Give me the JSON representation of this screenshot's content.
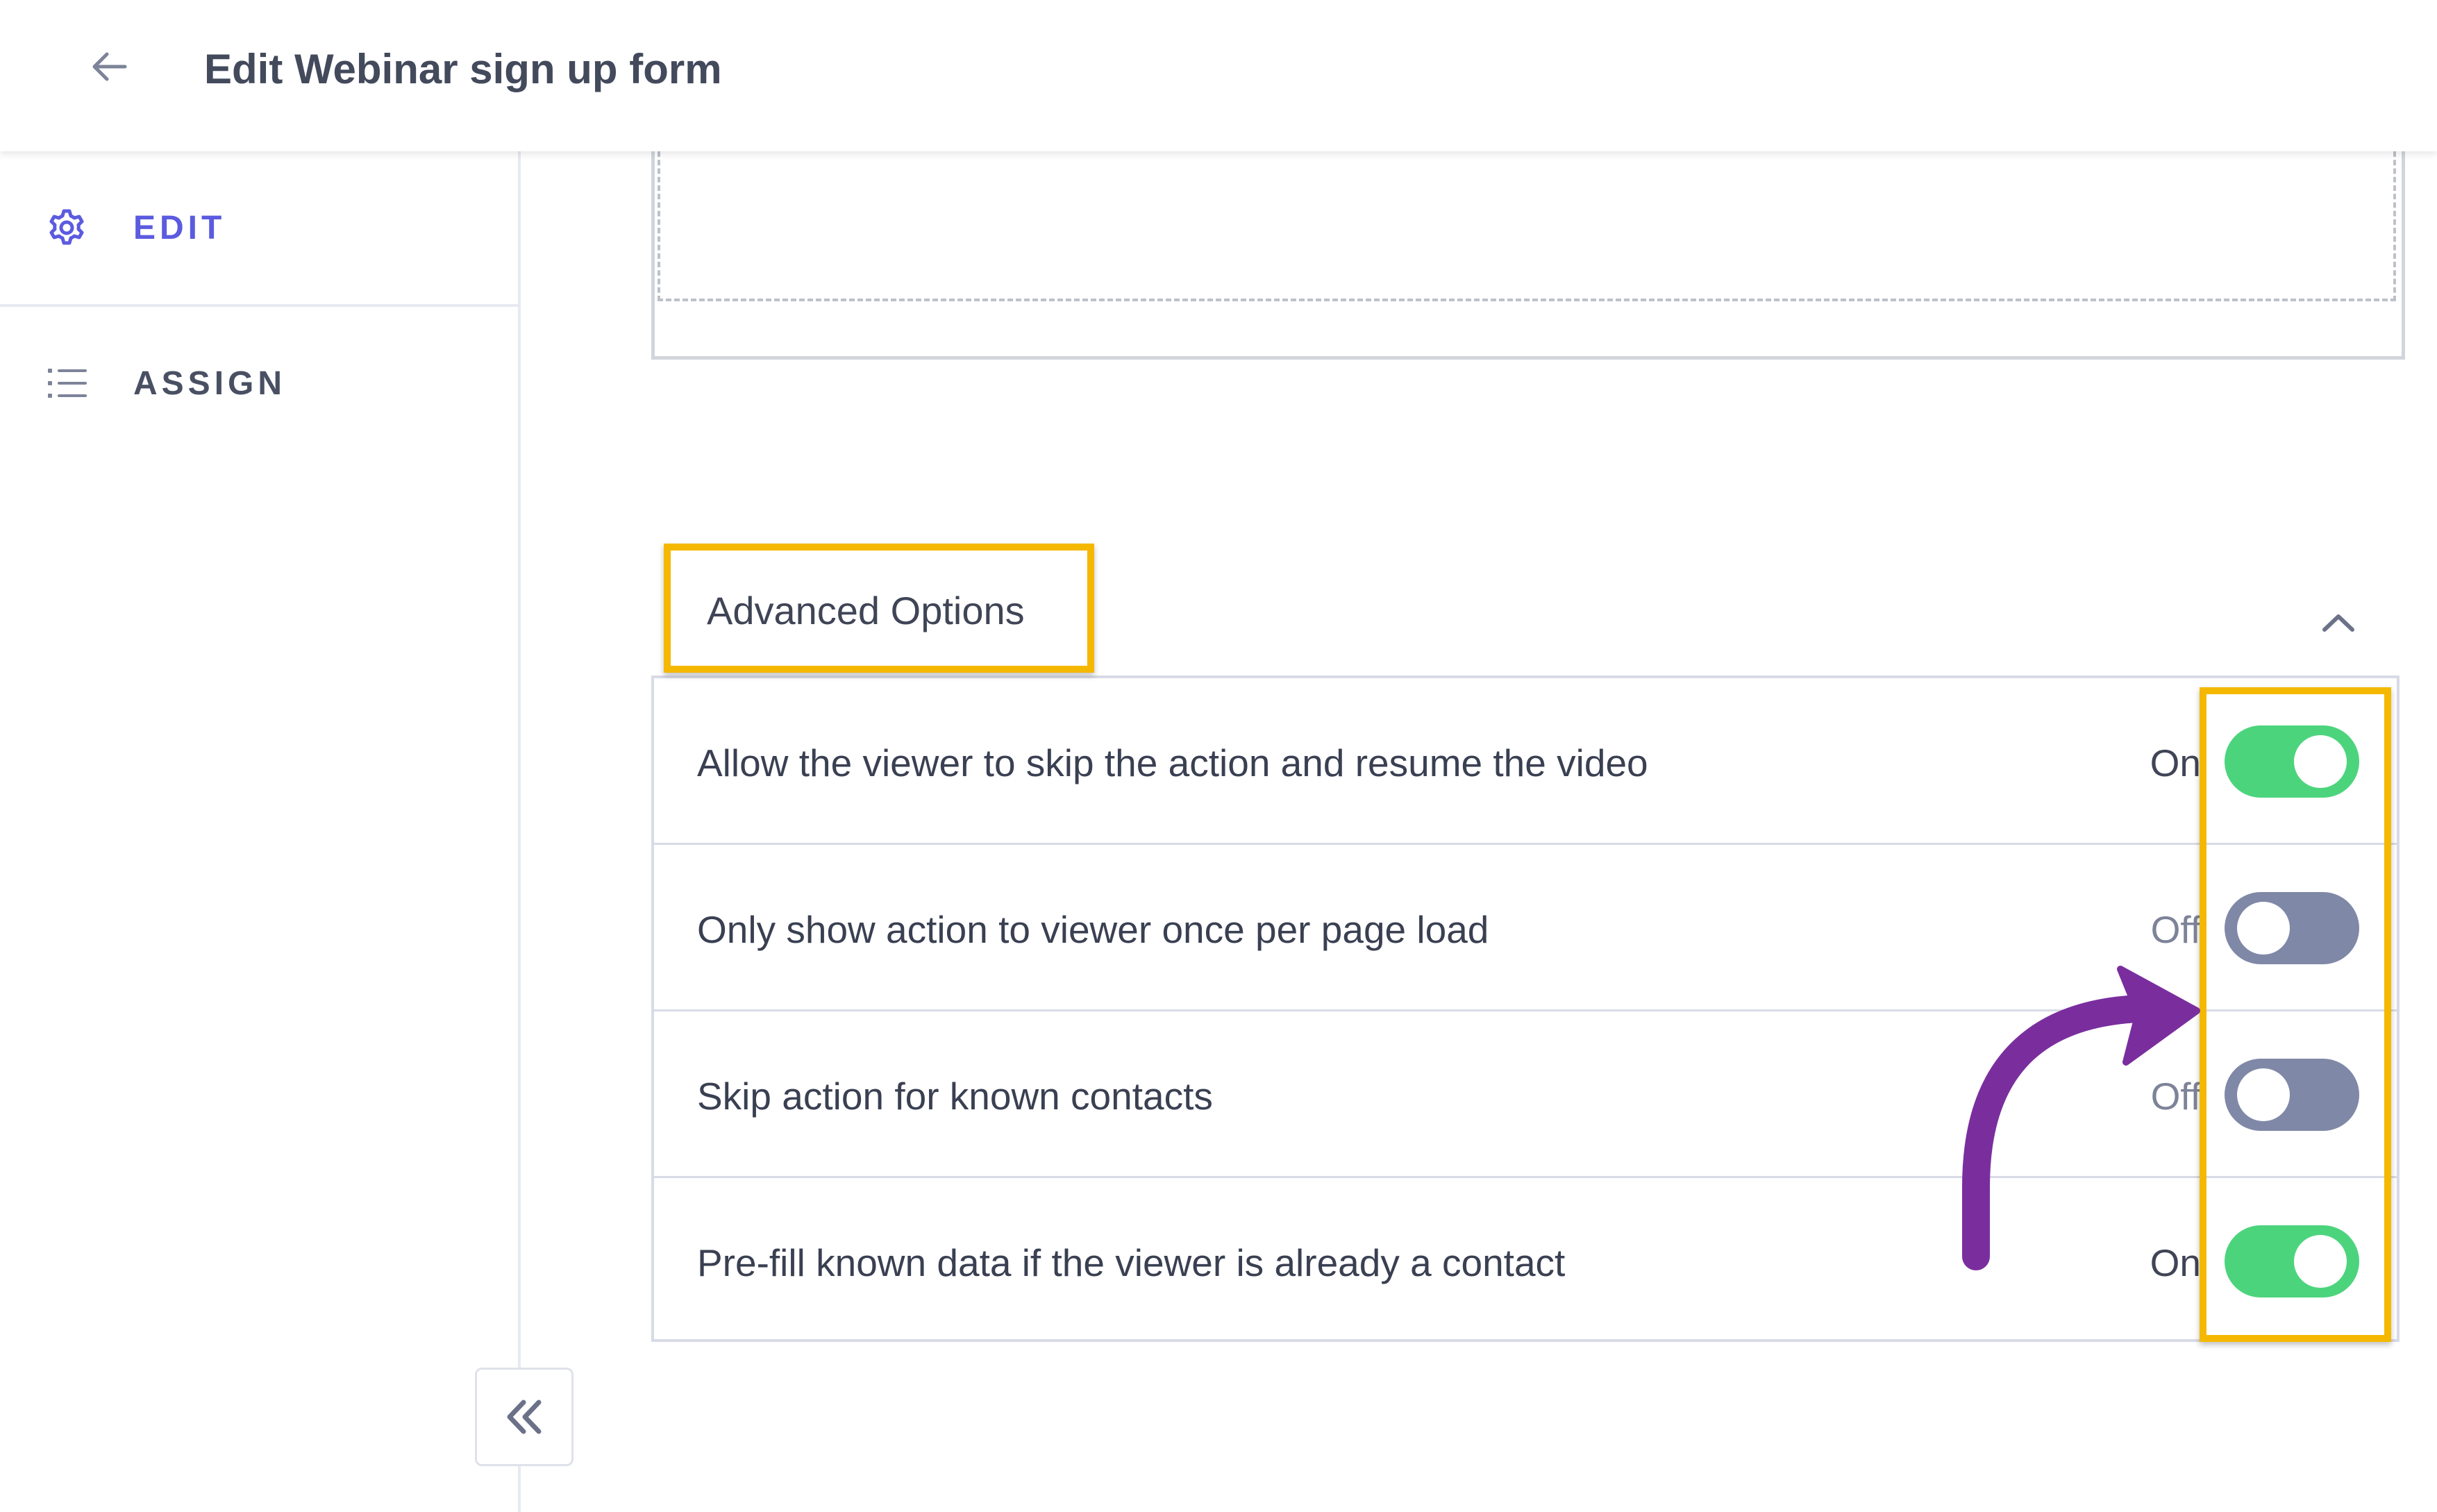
{
  "header": {
    "back_icon": "arrow-left-icon",
    "title": "Edit Webinar sign up form"
  },
  "sidebar": {
    "items": [
      {
        "label": "EDIT",
        "icon": "gear-icon",
        "active": true,
        "color": "#5b5be0"
      },
      {
        "label": "ASSIGN",
        "icon": "list-icon",
        "active": false
      }
    ],
    "collapse_icon": "double-chevron-left-icon"
  },
  "advanced_options": {
    "title": "Advanced Options",
    "expanded": true,
    "chevron_icon": "chevron-up-icon",
    "options": [
      {
        "label": "Allow the viewer to skip the action and resume the video",
        "state": "On",
        "enabled": true
      },
      {
        "label": "Only show action to viewer once per page load",
        "state": "Off",
        "enabled": false
      },
      {
        "label": "Skip action for known contacts",
        "state": "Off",
        "enabled": false
      },
      {
        "label": "Pre-fill known data if the viewer is already a contact",
        "state": "On",
        "enabled": true
      }
    ]
  },
  "annotations": {
    "highlight_color": "#f5b800",
    "arrow_color": "#7a2e9e",
    "arrow_icon": "curved-arrow-icon"
  },
  "colors": {
    "toggle_on": "#4cd47d",
    "toggle_off": "#7f88a6",
    "accent": "#5b5be0"
  }
}
